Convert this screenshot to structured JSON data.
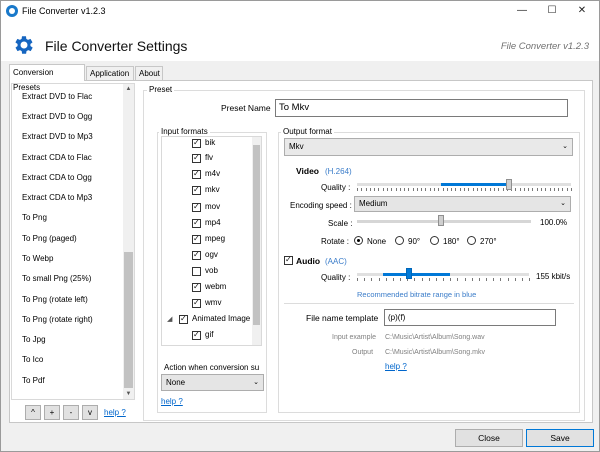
{
  "window": {
    "title": "File Converter v1.2.3",
    "controls": {
      "minimize": "—",
      "maximize": "☐",
      "close": "✕"
    }
  },
  "header": {
    "title": "File Converter Settings",
    "version": "File Converter v1.2.3"
  },
  "tabs": [
    {
      "label": "Conversion Presets",
      "active": true
    },
    {
      "label": "Application",
      "active": false
    },
    {
      "label": "About",
      "active": false
    }
  ],
  "presets": {
    "items": [
      "Extract DVD to Flac",
      "Extract DVD to Ogg",
      "Extract DVD to Mp3",
      "Extract CDA to Flac",
      "Extract CDA to Ogg",
      "Extract CDA to Mp3",
      "To Png",
      "To Png (paged)",
      "To Webp",
      "To small Png (25%)",
      "To Png (rotate left)",
      "To Png (rotate right)",
      "To Jpg",
      "To Ico",
      "To Pdf"
    ],
    "buttons": [
      "^",
      "+",
      "-",
      "v"
    ],
    "help": "help ?"
  },
  "preset_group": {
    "label": "Preset",
    "name_label": "Preset Name",
    "name_value": "To Mkv"
  },
  "input_formats": {
    "label": "Input formats",
    "items": [
      {
        "label": "bik",
        "checked": true
      },
      {
        "label": "flv",
        "checked": true
      },
      {
        "label": "m4v",
        "checked": true
      },
      {
        "label": "mkv",
        "checked": true
      },
      {
        "label": "mov",
        "checked": true
      },
      {
        "label": "mp4",
        "checked": true
      },
      {
        "label": "mpeg",
        "checked": true
      },
      {
        "label": "ogv",
        "checked": true
      },
      {
        "label": "vob",
        "checked": false
      },
      {
        "label": "webm",
        "checked": true
      },
      {
        "label": "wmv",
        "checked": true
      }
    ],
    "group_expander": "◢",
    "group_label": "Animated Image",
    "group_checked": true,
    "group_items": [
      {
        "label": "gif",
        "checked": true
      }
    ],
    "action_label": "Action when conversion su",
    "action_value": "None",
    "help": "help ?"
  },
  "output": {
    "label": "Output format",
    "format": "Mkv",
    "video_label": "Video",
    "video_codec": "(H.264)",
    "quality_label": "Quality :",
    "video_quality": 0.71,
    "speed_label": "Encoding speed :",
    "speed_value": "Medium",
    "scale_label": "Scale :",
    "scale_value": "100.0%",
    "scale_level": 0.48,
    "rotate_label": "Rotate :",
    "rotate_options": [
      "None",
      "90°",
      "180°",
      "270°"
    ],
    "rotate_selected": "None",
    "audio_label": "Audio",
    "audio_checked": true,
    "audio_codec": "(AAC)",
    "audio_quality_label": "Quality :",
    "audio_quality_value": "155 kbit/s",
    "audio_quality": 0.3,
    "audio_hint": "Recommended bitrate range in blue",
    "template_label": "File name template",
    "template_value": "(p)(f)",
    "input_example_label": "Input example",
    "input_example_value": "C:\\Music\\Artist\\Album\\Song.wav",
    "output_label": "Output",
    "output_value": "C:\\Music\\Artist\\Album\\Song.mkv",
    "help": "help ?"
  },
  "footer": {
    "close": "Close",
    "save": "Save"
  },
  "colors": {
    "accent": "#0078d7",
    "link": "#0066cc",
    "gear": "#1565c0"
  }
}
